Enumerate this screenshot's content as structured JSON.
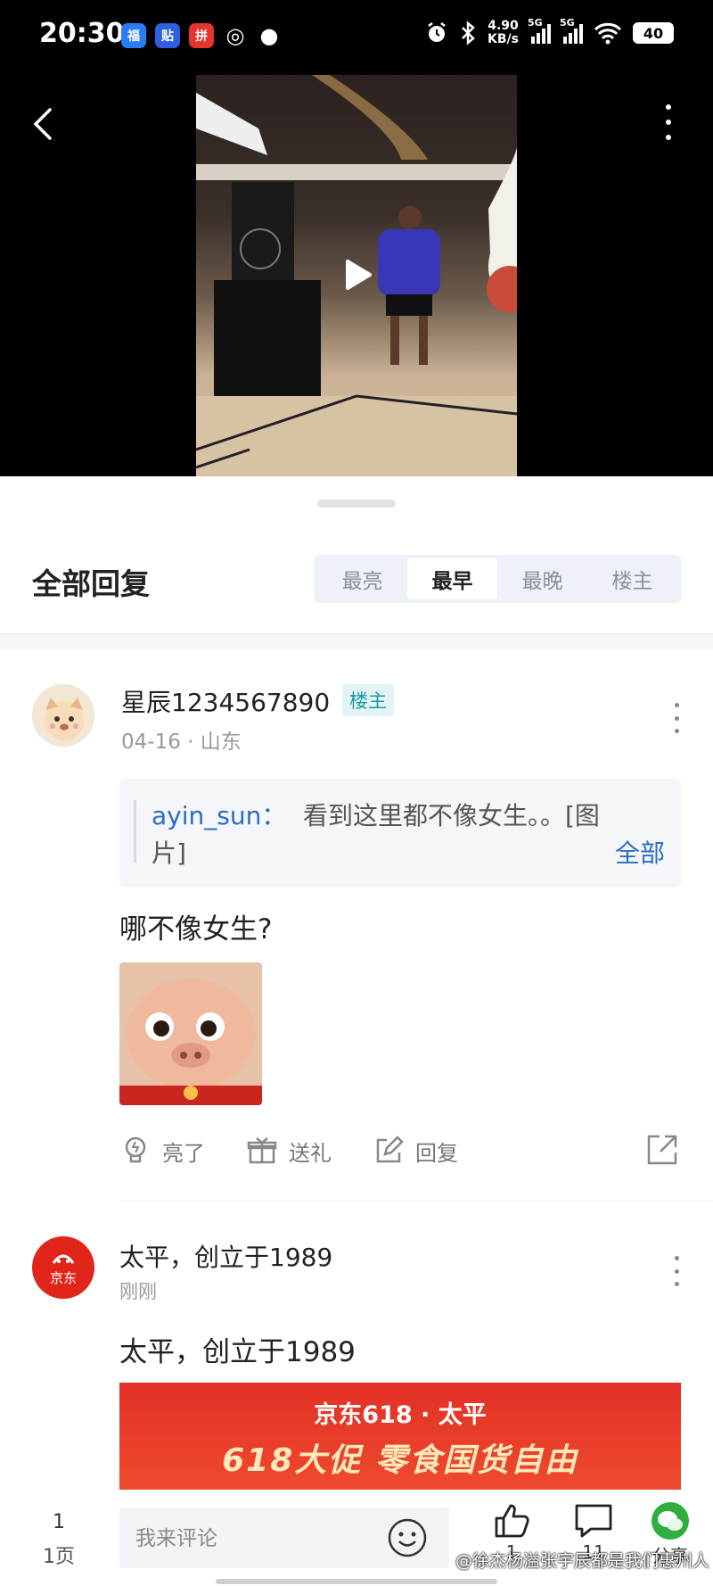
{
  "status_bar": {
    "time": "20:30",
    "app_icons": [
      {
        "glyph": "福",
        "icon": "baidu-app-icon",
        "color": "#2a7cf6"
      },
      {
        "glyph": "贴",
        "icon": "tieba-app-icon",
        "color": "#2f5fe0"
      },
      {
        "glyph": "拼",
        "icon": "pinduoduo-app-icon",
        "color": "#e5332e"
      },
      {
        "glyph": "◎",
        "icon": "loop-app-icon",
        "color": "#000000"
      },
      {
        "glyph": "●",
        "icon": "wechat-app-icon",
        "color": "#000000"
      }
    ],
    "net_speed": "4.90",
    "net_unit": "KB/s",
    "sig1_label": "5G",
    "sig2_label": "5G",
    "battery": "40"
  },
  "sheet": {
    "title": "全部回复",
    "sort_tabs": [
      {
        "label": "最亮",
        "active": false
      },
      {
        "label": "最早",
        "active": true
      },
      {
        "label": "最晚",
        "active": false
      },
      {
        "label": "楼主",
        "active": false
      }
    ]
  },
  "comment1": {
    "username": "星辰1234567890",
    "badge": "楼主",
    "meta": "04-16 · 山东",
    "quote_user": "ayin_sun：",
    "quote_text": "看到这里都不像女生。。[图",
    "quote_text2": "片]",
    "quote_all": "全部",
    "text": "哪不像女生?",
    "actions": {
      "like": "亮了",
      "gift": "送礼",
      "reply": "回复"
    }
  },
  "comment2": {
    "username": "太平，创立于1989",
    "avatar_text": "京东",
    "meta": "刚刚",
    "text": "太平，创立于1989",
    "ad_line1": "京东618 · 太平",
    "ad_line2": "618大促 零食国货自由"
  },
  "bottom_bar": {
    "page_num": "1",
    "page_label": "1页",
    "input_placeholder": "我来评论",
    "likes": "1",
    "comments": "11",
    "share": "分享",
    "watermark": "@徐杰杨溢张宇辰都是我们惠州人"
  }
}
